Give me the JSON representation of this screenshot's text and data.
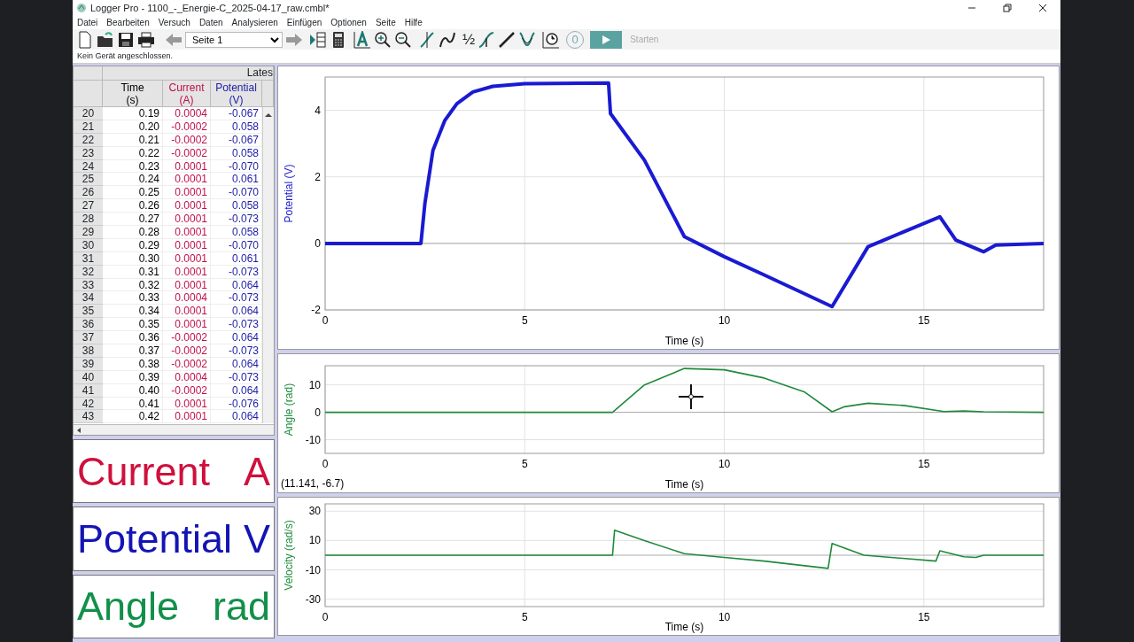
{
  "window": {
    "title": "Logger Pro - 1100_-_Energie-C_2025-04-17_raw.cmbl*"
  },
  "menu": [
    "Datei",
    "Bearbeiten",
    "Versuch",
    "Daten",
    "Analysieren",
    "Einfügen",
    "Optionen",
    "Seite",
    "Hilfe"
  ],
  "toolbar": {
    "page": "Seite 1",
    "fraction_label": "½",
    "zero_label": "0",
    "start": {
      "label": "Starten",
      "disabled": true
    }
  },
  "status": "Kein Gerät angeschlossen.",
  "table": {
    "title": "Lates",
    "columns": [
      {
        "name": "Time",
        "unit": "(s)",
        "color": "#000000"
      },
      {
        "name": "Current",
        "unit": "(A)",
        "color": "#c01048"
      },
      {
        "name": "Potential",
        "unit": "(V)",
        "color": "#1c1ca8"
      }
    ],
    "rows": [
      {
        "index": "20",
        "cells": [
          "0.19",
          "0.0004",
          "-0.067"
        ]
      },
      {
        "index": "21",
        "cells": [
          "0.20",
          "-0.0002",
          "0.058"
        ]
      },
      {
        "index": "22",
        "cells": [
          "0.21",
          "-0.0002",
          "-0.067"
        ]
      },
      {
        "index": "23",
        "cells": [
          "0.22",
          "-0.0002",
          "0.058"
        ]
      },
      {
        "index": "24",
        "cells": [
          "0.23",
          "0.0001",
          "-0.070"
        ]
      },
      {
        "index": "25",
        "cells": [
          "0.24",
          "0.0001",
          "0.061"
        ]
      },
      {
        "index": "26",
        "cells": [
          "0.25",
          "0.0001",
          "-0.070"
        ]
      },
      {
        "index": "27",
        "cells": [
          "0.26",
          "0.0001",
          "0.058"
        ]
      },
      {
        "index": "28",
        "cells": [
          "0.27",
          "0.0001",
          "-0.073"
        ]
      },
      {
        "index": "29",
        "cells": [
          "0.28",
          "0.0001",
          "0.058"
        ]
      },
      {
        "index": "30",
        "cells": [
          "0.29",
          "0.0001",
          "-0.070"
        ]
      },
      {
        "index": "31",
        "cells": [
          "0.30",
          "0.0001",
          "0.061"
        ]
      },
      {
        "index": "32",
        "cells": [
          "0.31",
          "0.0001",
          "-0.073"
        ]
      },
      {
        "index": "33",
        "cells": [
          "0.32",
          "0.0001",
          "0.064"
        ]
      },
      {
        "index": "34",
        "cells": [
          "0.33",
          "0.0004",
          "-0.073"
        ]
      },
      {
        "index": "35",
        "cells": [
          "0.34",
          "0.0001",
          "0.064"
        ]
      },
      {
        "index": "36",
        "cells": [
          "0.35",
          "0.0001",
          "-0.073"
        ]
      },
      {
        "index": "37",
        "cells": [
          "0.36",
          "-0.0002",
          "0.064"
        ]
      },
      {
        "index": "38",
        "cells": [
          "0.37",
          "-0.0002",
          "-0.073"
        ]
      },
      {
        "index": "39",
        "cells": [
          "0.38",
          "-0.0002",
          "0.064"
        ]
      },
      {
        "index": "40",
        "cells": [
          "0.39",
          "0.0004",
          "-0.073"
        ]
      },
      {
        "index": "41",
        "cells": [
          "0.40",
          "-0.0002",
          "0.064"
        ]
      },
      {
        "index": "42",
        "cells": [
          "0.41",
          "0.0001",
          "-0.076"
        ]
      },
      {
        "index": "43",
        "cells": [
          "0.42",
          "0.0001",
          "0.064"
        ]
      }
    ]
  },
  "meters": [
    {
      "name": "Current",
      "unit": "A",
      "color": "#d0103c"
    },
    {
      "name": "Potential",
      "unit": "V",
      "color": "#1414b4"
    },
    {
      "name": "Angle",
      "unit": "rad",
      "color": "#12904a"
    }
  ],
  "graphs": [
    {
      "chart_data": {
        "type": "line",
        "xlabel": "Time (s)",
        "ylabel": "Potential (V)",
        "xlim": [
          0,
          18
        ],
        "ylim": [
          -2,
          5
        ],
        "xticks": [
          0,
          5,
          10,
          15
        ],
        "yticks": [
          -2,
          0,
          2,
          4
        ],
        "x": [
          0,
          2.4,
          2.5,
          2.7,
          3,
          3.3,
          3.7,
          4.2,
          5,
          7.1,
          7.15,
          8,
          9,
          10,
          11,
          12.7,
          13.6,
          14,
          15.4,
          15.8,
          16.5,
          16.8,
          18
        ],
        "grid": true,
        "series": [
          {
            "color": "#1a1ad2",
            "values": [
              0,
              0,
              1.2,
              2.8,
              3.7,
              4.2,
              4.55,
              4.72,
              4.8,
              4.82,
              3.9,
              2.5,
              0.2,
              -0.4,
              -0.95,
              -1.9,
              -0.1,
              0.1,
              0.8,
              0.1,
              -0.25,
              -0.05,
              0
            ]
          }
        ]
      }
    },
    {
      "readout": "(11.141, -6.7)",
      "chart_data": {
        "type": "line",
        "xlabel": "Time (s)",
        "ylabel": "Angle (rad)",
        "xlim": [
          0,
          18
        ],
        "ylim": [
          -15,
          17
        ],
        "xticks": [
          0,
          5,
          10,
          15
        ],
        "yticks": [
          -10,
          0,
          10
        ],
        "x": [
          0,
          7.2,
          8,
          9,
          10,
          11,
          12,
          12.7,
          13,
          13.6,
          14.5,
          15.5,
          16,
          16.5,
          18
        ],
        "grid": true,
        "series": [
          {
            "color": "#1f8a3c",
            "values": [
              0,
              0,
              10,
              16,
              15.5,
              12.5,
              7.5,
              0.2,
              2,
              3.3,
              2.5,
              0.3,
              0.5,
              0.2,
              0
            ]
          }
        ]
      }
    },
    {
      "chart_data": {
        "type": "line",
        "xlabel": "Time (s)",
        "ylabel": "Velocity (rad/s)",
        "xlim": [
          0,
          18
        ],
        "ylim": [
          -35,
          35
        ],
        "xticks": [
          0,
          5,
          10,
          15
        ],
        "yticks": [
          -30,
          -10,
          10,
          30
        ],
        "x": [
          0,
          7.2,
          7.25,
          8,
          9,
          10,
          11,
          12.6,
          12.7,
          13.5,
          15.3,
          15.4,
          16,
          16.3,
          16.5,
          18
        ],
        "grid": true,
        "series": [
          {
            "color": "#1f8a3c",
            "values": [
              0,
              0,
              17,
              10,
              1,
              -1.5,
              -4,
              -9,
              8,
              0,
              -4,
              3,
              -1,
              -1.5,
              0,
              0
            ]
          }
        ]
      }
    }
  ]
}
